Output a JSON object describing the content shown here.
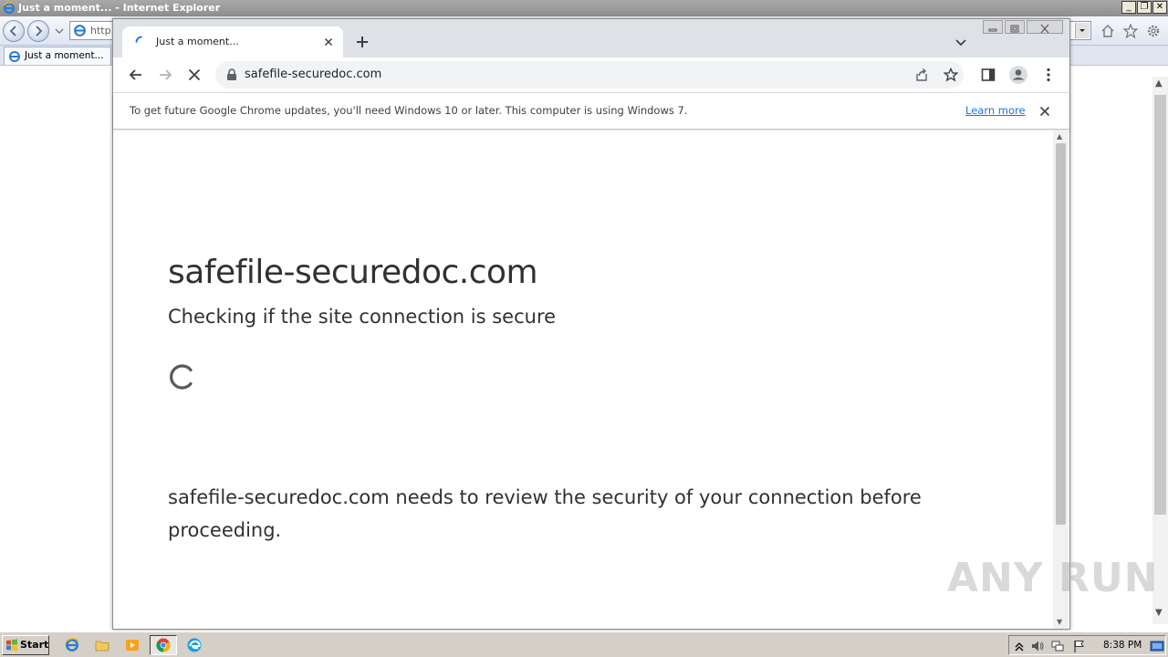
{
  "ie": {
    "title": "Just a moment... - Internet Explorer",
    "address_visible": "http:",
    "tab_label": "Just a moment..."
  },
  "chrome": {
    "tab_title": "Just a moment...",
    "url": "safefile-securedoc.com",
    "infobar_text": "To get future Google Chrome updates, you'll need Windows 10 or later. This computer is using Windows 7.",
    "infobar_link": "Learn more"
  },
  "page": {
    "site_title": "safefile-securedoc.com",
    "subtitle": "Checking if the site connection is secure",
    "body": "safefile-securedoc.com needs to review the security of your connection before proceeding."
  },
  "watermark": "ANY RUN",
  "taskbar": {
    "start_label": "Start",
    "clock": "8:38 PM"
  },
  "colors": {
    "chrome_accent": "#1a73e8",
    "page_text": "#313131",
    "ie_titlebar": "#8e8e8e"
  },
  "icons": {
    "ie_back": "back-arrow-icon",
    "ie_forward": "forward-arrow-icon",
    "chrome_reload_stop": "stop-icon",
    "lock": "lock-icon",
    "share": "share-icon",
    "star": "bookmark-star-icon",
    "sidepanel": "side-panel-icon",
    "profile": "profile-icon",
    "menu": "kebab-menu-icon"
  }
}
